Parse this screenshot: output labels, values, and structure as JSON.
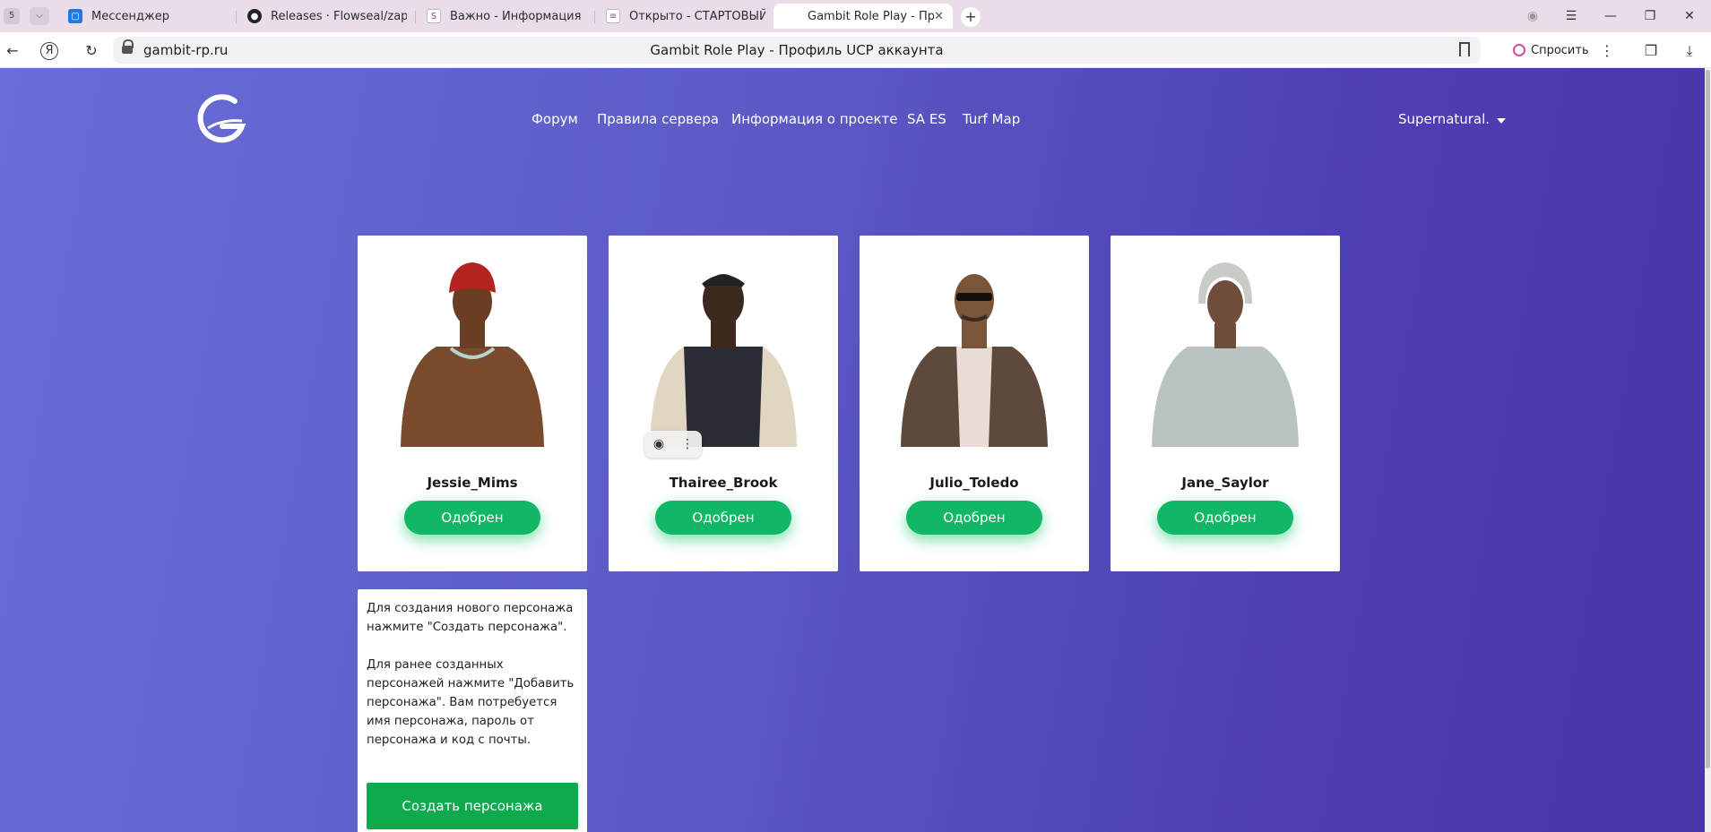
{
  "browser": {
    "tab_count": "5",
    "tabs": [
      {
        "label": "Мессенджер",
        "icon": "messenger-icon"
      },
      {
        "label": "Releases · Flowseal/zapret",
        "icon": "github-icon"
      },
      {
        "label": "Важно - Информация - Ka",
        "icon": "forum-icon"
      },
      {
        "label": "Открыто - СТАРТОВЫЙ С",
        "icon": "forum-icon"
      },
      {
        "label": "Gambit Role Play - Проф",
        "icon": "gambit-icon",
        "active": true
      }
    ],
    "url": "gambit-rp.ru",
    "page_title": "Gambit Role Play - Профиль UCP аккаунта",
    "ask_label": "Спросить"
  },
  "site": {
    "nav": [
      "Форум",
      "Правила сервера",
      "Информация о проекте",
      "SA ES",
      "Turf Map"
    ],
    "username": "Supernatural."
  },
  "characters": [
    {
      "name": "Jessie_Mims",
      "status": "Одобрен"
    },
    {
      "name": "Thairee_Brook",
      "status": "Одобрен"
    },
    {
      "name": "Julio_Toledo",
      "status": "Одобрен"
    },
    {
      "name": "Jane_Saylor",
      "status": "Одобрен"
    }
  ],
  "info": {
    "paragraph1": "Для создания нового персонажа нажмите \"Создать персонажа\".",
    "paragraph2": "Для ранее созданных персонажей нажмите \"Добавить персонажа\". Вам потребуется имя персонажа, пароль от персонажа и код с почты.",
    "create_button": "Создать персонажа"
  },
  "colors": {
    "accent_green": "#11b765",
    "page_gradient_start": "#6a6dd6",
    "page_gradient_end": "#4a36a8"
  }
}
